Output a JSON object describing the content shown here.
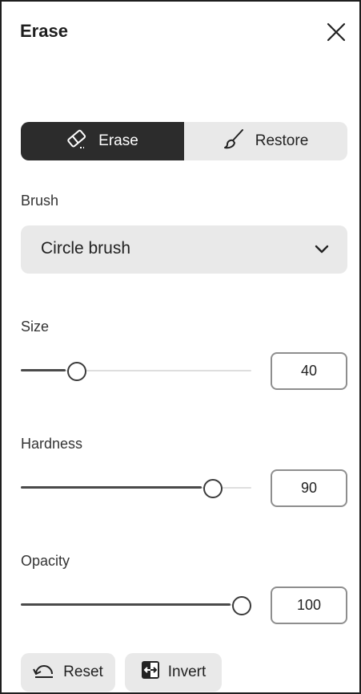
{
  "panel": {
    "title": "Erase"
  },
  "mode": {
    "options": [
      {
        "label": "Erase",
        "icon": "eraser-icon",
        "selected": true
      },
      {
        "label": "Restore",
        "icon": "brush-icon",
        "selected": false
      }
    ]
  },
  "brush": {
    "label": "Brush",
    "selected": "Circle brush"
  },
  "size": {
    "label": "Size",
    "value": "40",
    "fraction": 0.22
  },
  "hardness": {
    "label": "Hardness",
    "value": "90",
    "fraction": 0.865
  },
  "opacity": {
    "label": "Opacity",
    "value": "100",
    "fraction": 1.0
  },
  "actions": {
    "reset_label": "Reset",
    "invert_label": "Invert"
  },
  "colors": {
    "active_segment": "#2c2c2c",
    "control_bg": "#e9e9e9",
    "border": "#1e1e1e"
  }
}
